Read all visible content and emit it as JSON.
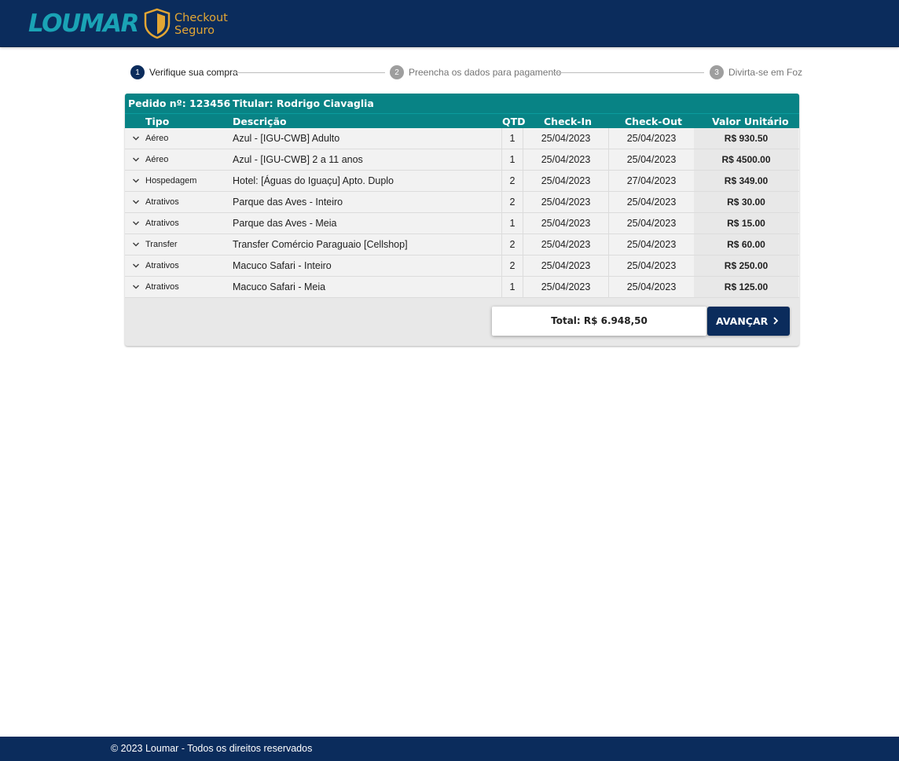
{
  "header": {
    "brand": "LOUMAR",
    "secure_line1": "Checkout",
    "secure_line2": "Seguro",
    "brand_color": "#1aa3b5",
    "secure_color": "#e3a634",
    "bar_color": "#0b2c5c"
  },
  "stepper": {
    "steps": [
      {
        "number": "1",
        "label": "Verifique sua compra",
        "active": true
      },
      {
        "number": "2",
        "label": "Preencha os dados para pagamento",
        "active": false
      },
      {
        "number": "3",
        "label": "Divirta-se em Foz",
        "active": false
      }
    ]
  },
  "order": {
    "number_label": "Pedido nº: 123456",
    "holder_label": "Titular: Rodrigo Ciavaglia",
    "columns": {
      "tipo": "Tipo",
      "descricao": "Descrição",
      "qtd": "QTD",
      "checkin": "Check-In",
      "checkout": "Check-Out",
      "valor": "Valor Unitário"
    },
    "items": [
      {
        "tipo": "Aéreo",
        "descricao": "Azul - [IGU-CWB] Adulto",
        "qtd": "1",
        "checkin": "25/04/2023",
        "checkout": "25/04/2023",
        "valor": "R$ 930.50"
      },
      {
        "tipo": "Aéreo",
        "descricao": "Azul - [IGU-CWB] 2 a 11 anos",
        "qtd": "1",
        "checkin": "25/04/2023",
        "checkout": "25/04/2023",
        "valor": "R$ 4500.00"
      },
      {
        "tipo": "Hospedagem",
        "descricao": "Hotel: [Águas do Iguaçu] Apto. Duplo",
        "qtd": "2",
        "checkin": "25/04/2023",
        "checkout": "27/04/2023",
        "valor": "R$ 349.00"
      },
      {
        "tipo": "Atrativos",
        "descricao": "Parque das Aves - Inteiro",
        "qtd": "2",
        "checkin": "25/04/2023",
        "checkout": "25/04/2023",
        "valor": "R$ 30.00"
      },
      {
        "tipo": "Atrativos",
        "descricao": "Parque das Aves - Meia",
        "qtd": "1",
        "checkin": "25/04/2023",
        "checkout": "25/04/2023",
        "valor": "R$ 15.00"
      },
      {
        "tipo": "Transfer",
        "descricao": "Transfer Comércio Paraguaio [Cellshop]",
        "qtd": "2",
        "checkin": "25/04/2023",
        "checkout": "25/04/2023",
        "valor": "R$ 60.00"
      },
      {
        "tipo": "Atrativos",
        "descricao": "Macuco Safari - Inteiro",
        "qtd": "2",
        "checkin": "25/04/2023",
        "checkout": "25/04/2023",
        "valor": "R$ 250.00"
      },
      {
        "tipo": "Atrativos",
        "descricao": "Macuco Safari - Meia",
        "qtd": "1",
        "checkin": "25/04/2023",
        "checkout": "25/04/2023",
        "valor": "R$ 125.00"
      }
    ],
    "total_label": "Total: R$ 6.948,50",
    "advance_label": "AVANÇAR",
    "accent_color": "#088385"
  },
  "footer": {
    "copyright": "© 2023 Loumar - Todos os direitos reservados"
  }
}
